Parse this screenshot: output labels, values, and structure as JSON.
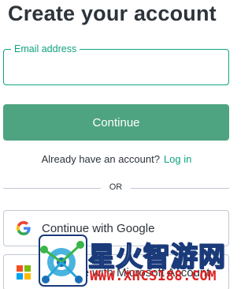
{
  "header": {
    "title": "Create your account"
  },
  "email": {
    "label": "Email address",
    "value": "",
    "placeholder": ""
  },
  "continue_button": {
    "label": "Continue"
  },
  "login_prompt": {
    "text": "Already have an account?",
    "link": "Log in"
  },
  "divider": {
    "text": "OR"
  },
  "social": {
    "google_label": "Continue with Google",
    "microsoft_label": "Continue with Microsoft Account"
  },
  "watermark": {
    "cn_text": "星火智游网",
    "url": "WWW.XHCS188.COM"
  },
  "colors": {
    "accent": "#10a37f",
    "button": "#4ea381",
    "text": "#2d333a",
    "border": "#c2c8d0"
  }
}
